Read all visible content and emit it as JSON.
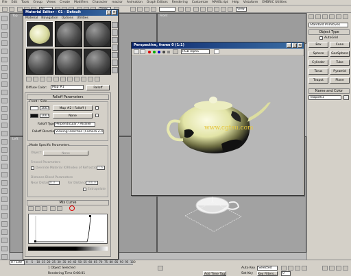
{
  "menu": [
    "File",
    "Edit",
    "Tools",
    "Group",
    "Views",
    "Create",
    "Modifiers",
    "Character",
    "reactor",
    "Animation",
    "Graph Editors",
    "Rendering",
    "Customize",
    "MAXScript",
    "Help",
    "Vistaform",
    "EMBRIC Utilities"
  ],
  "toolbar": {
    "selection_filter": "All",
    "ref_coord": "View",
    "named_sel": "",
    "view_dropdown2": "View"
  },
  "viewports": {
    "top_label": "Top",
    "front_label": "Front",
    "left_label": "Left"
  },
  "material_editor": {
    "title": "Material Editor - 01 - Default",
    "menu": [
      "Material",
      "Navigation",
      "Options",
      "Utilities"
    ],
    "diffuse_label": "Diffuse Color:",
    "map_name": "Map #1",
    "map_type": "Falloff",
    "falloff_params_header": "Falloff Parameters",
    "front_side_label": "Front : Side",
    "spinner1": "100.0",
    "spinner2": "100.0",
    "map2_label": "Map #2 ( Falloff )",
    "none_label": "None",
    "falloff_type_label": "Falloff Type:",
    "falloff_type_value": "Perpendicular / Parallel",
    "falloff_dir_label": "Falloff Direction:",
    "falloff_dir_value": "Viewing Direction (Camera Z-Axis)",
    "mode_specific_header": "Mode Specific Parameters",
    "object_label": "Object:",
    "object_value": "None",
    "fresnel_header": "Fresnel Parameters",
    "override_ior_label": "Override Material IOR",
    "ior_label": "Index of Refraction",
    "ior_value": "1.6",
    "distance_blend_header": "Distance Blend Parameters",
    "near_label": "Near Distance:",
    "near_value": "0.0",
    "far_label": "Far Distance:",
    "far_value": "100.0",
    "extrapolate_label": "Extrapolate",
    "mix_curve_header": "Mix Curve"
  },
  "render_window": {
    "title": "Perspective, frame 0 (1:1)",
    "channel": "RGB Alpha",
    "watermark": "www.cgtsu.com"
  },
  "command_panel": {
    "category": "Standard Primitives",
    "object_type_header": "Object Type",
    "autogrid_label": "AutoGrid",
    "buttons": [
      "Box",
      "Cone",
      "Sphere",
      "GeoSphere",
      "Cylinder",
      "Tube",
      "Torus",
      "Pyramid",
      "Teapot",
      "Plane"
    ],
    "name_color_header": "Name and Color",
    "object_name": "Teapot01"
  },
  "statusbar": {
    "time_position": "0 / 100",
    "selected_text": "1 Object Selected",
    "rendering_time": "Rendering Time  0:00:01",
    "add_time_tag": "Add Time Tag",
    "auto_key": "Auto Key",
    "selected_dropdown": "Selected",
    "set_key": "Set Key",
    "key_filters": "Key Filters...",
    "frame_number": "0"
  },
  "timeline_ticks": [
    "0",
    "5",
    "10",
    "15",
    "20",
    "25",
    "30",
    "35",
    "40",
    "45",
    "50",
    "55",
    "60",
    "65",
    "70",
    "75",
    "80",
    "85",
    "90",
    "95",
    "100"
  ]
}
